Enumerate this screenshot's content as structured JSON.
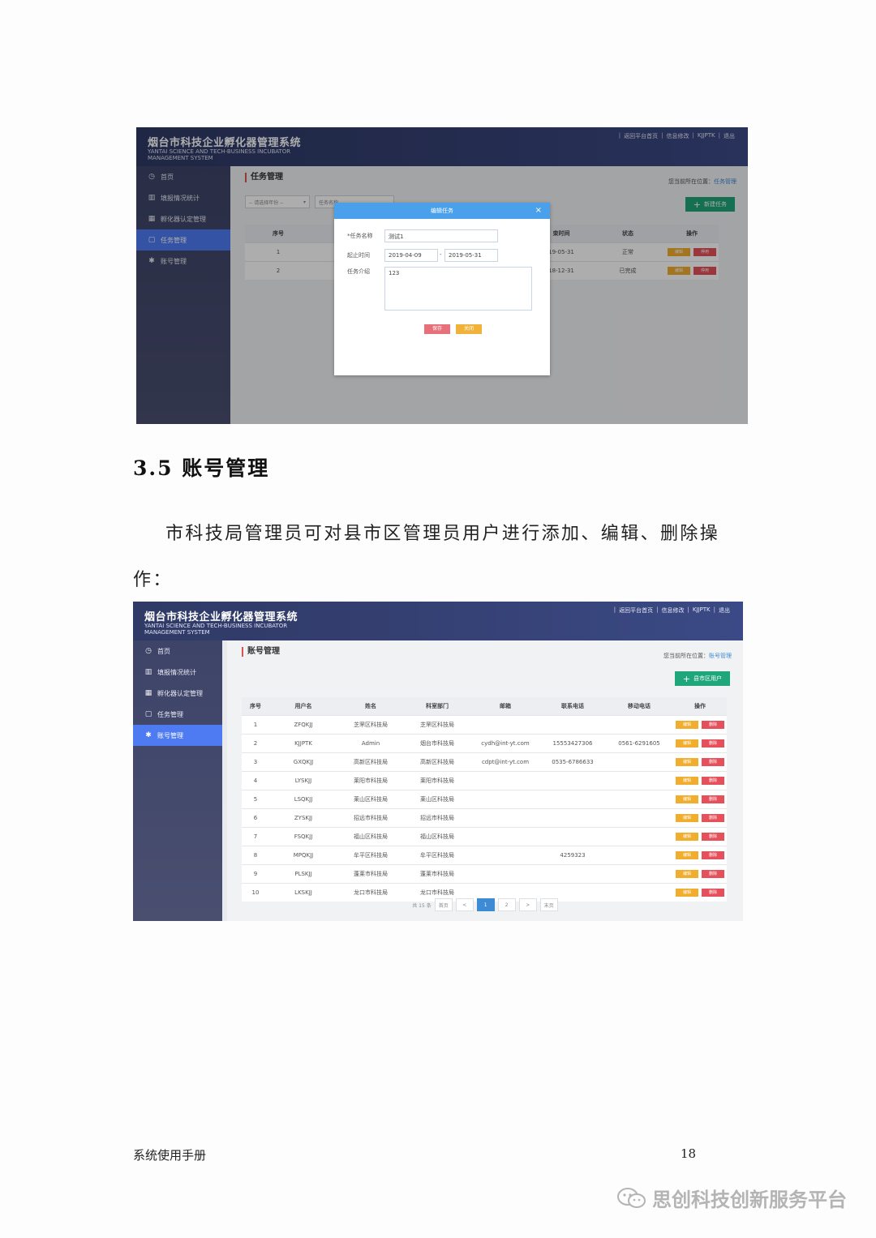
{
  "app": {
    "title_cn": "烟台市科技企业孵化器管理系统",
    "title_en": "YANTAI SCIENCE AND TECH-BUSINESS INCUBATOR MANAGEMENT SYSTEM",
    "toplinks": [
      "返回平台首页",
      "信息修改",
      "KJJPTK",
      "退出"
    ]
  },
  "sidebar": {
    "items": [
      {
        "label": "首页",
        "icon": "clock-icon"
      },
      {
        "label": "填报情况统计",
        "icon": "bar-chart-icon"
      },
      {
        "label": "孵化器认定管理",
        "icon": "grid-icon"
      },
      {
        "label": "任务管理",
        "icon": "chat-icon"
      },
      {
        "label": "账号管理",
        "icon": "gear-icon"
      }
    ]
  },
  "shot1": {
    "page_title": "任务管理",
    "crumb_prefix": "您当前所在位置：",
    "crumb_current": "任务管理",
    "add_button": "新建任务",
    "filter_select": "-- 请选择年份 --",
    "filter_input": "任务名称",
    "table": {
      "headers": [
        "序号",
        "",
        "束时间",
        "状态",
        "操作"
      ],
      "rows": [
        {
          "no": "1",
          "end": "19-05-31",
          "status": "正常"
        },
        {
          "no": "2",
          "end": "18-12-31",
          "status": "已完成"
        }
      ],
      "edit_label": "编辑",
      "stop_label": "停用"
    },
    "modal": {
      "title": "编辑任务",
      "name_label": "*任务名称",
      "name_value": "测试1",
      "period_label": "起止时间",
      "start": "2019-04-09",
      "dash": "-",
      "end": "2019-05-31",
      "intro_label": "任务介绍",
      "intro_value": "123",
      "save": "保存",
      "close": "关闭"
    }
  },
  "section": {
    "title": "3.5 账号管理",
    "paragraph": "市科技局管理员可对县市区管理员用户进行添加、编辑、删除操作："
  },
  "shot2": {
    "page_title": "账号管理",
    "crumb_prefix": "您当前所在位置：",
    "crumb_current": "账号管理",
    "add_button": "县市区用户",
    "table": {
      "headers": [
        "序号",
        "用户名",
        "姓名",
        "科室部门",
        "邮箱",
        "联系电话",
        "移动电话",
        "操作"
      ],
      "rows": [
        [
          "1",
          "ZFQKJJ",
          "芝罘区科技局",
          "芝罘区科技局",
          "",
          "",
          ""
        ],
        [
          "2",
          "KJJPTK",
          "Admin",
          "烟台市科技局",
          "cydh@int-yt.com",
          "15553427306",
          "0561-6291605"
        ],
        [
          "3",
          "GXQKJJ",
          "高新区科技局",
          "高新区科技局",
          "cdpt@int-yt.com",
          "0535-6786633",
          ""
        ],
        [
          "4",
          "LYSKJJ",
          "莱阳市科技局",
          "莱阳市科技局",
          "",
          "",
          ""
        ],
        [
          "5",
          "LSQKJJ",
          "莱山区科技局",
          "莱山区科技局",
          "",
          "",
          ""
        ],
        [
          "6",
          "ZYSKJJ",
          "招远市科技局",
          "招远市科技局",
          "",
          "",
          ""
        ],
        [
          "7",
          "FSQKJJ",
          "福山区科技局",
          "福山区科技局",
          "",
          "",
          ""
        ],
        [
          "8",
          "MPQKJJ",
          "牟平区科技局",
          "牟平区科技局",
          "",
          "4259323",
          ""
        ],
        [
          "9",
          "PLSKJJ",
          "蓬莱市科技局",
          "蓬莱市科技局",
          "",
          "",
          ""
        ],
        [
          "10",
          "LKSKJJ",
          "龙口市科技局",
          "龙口市科技局",
          "",
          "",
          ""
        ]
      ],
      "edit_label": "编辑",
      "del_label": "删除"
    },
    "pager": {
      "total": "共 15 条",
      "first": "首页",
      "prev": "<",
      "pages": [
        "1",
        "2"
      ],
      "current": "1",
      "next": ">",
      "last": "末页"
    }
  },
  "footer": {
    "left": "系统使用手册",
    "page": "18"
  },
  "watermark": {
    "text": "思创科技创新服务平台",
    "icon": "wechat-icon"
  },
  "colors": {
    "header": "#343f70",
    "active_nav": "#4f7bf2",
    "add_button": "#1fa67a",
    "edit_button": "#f0ad2e",
    "delete_button": "#e5505a",
    "modal_header": "#4aa0ea"
  }
}
